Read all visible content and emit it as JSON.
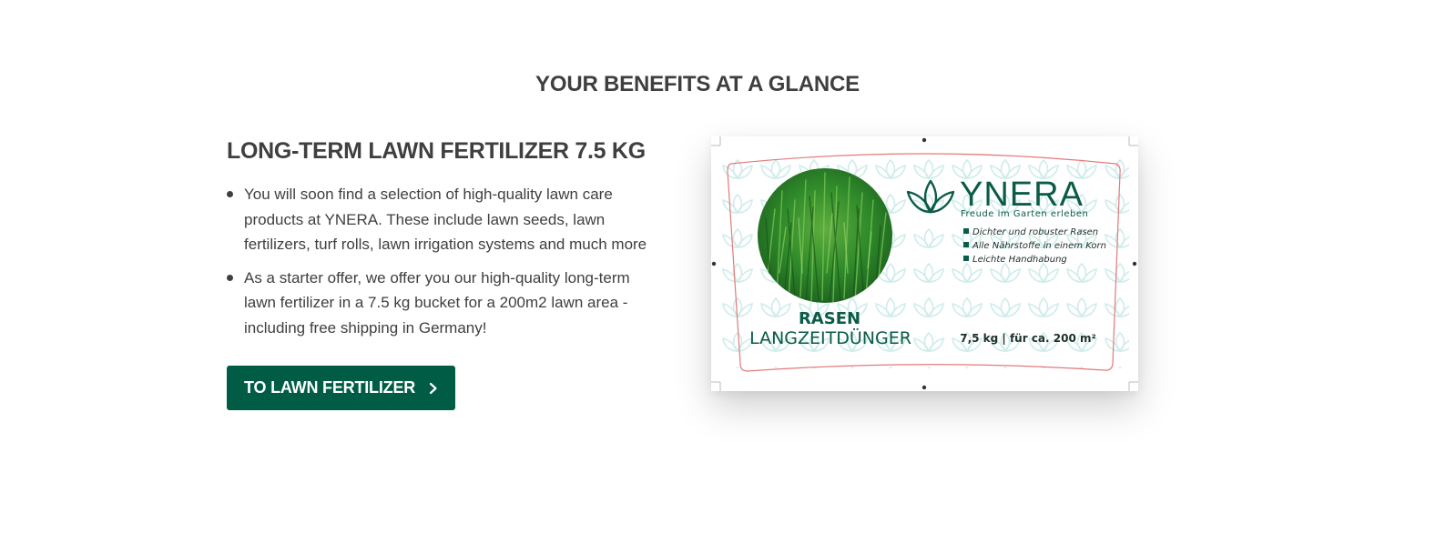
{
  "section": {
    "title": "YOUR BENEFITS AT A GLANCE"
  },
  "product": {
    "title": "LONG-TERM LAWN FERTILIZER 7.5 KG",
    "benefits": [
      "You will soon find a selection of high-quality lawn care products at YNERA. These include lawn seeds, lawn fertilizers, turf rolls, lawn irrigation systems and much more",
      "As a starter offer, we offer you our high-quality long-term lawn fertilizer in a 7.5 kg bucket for a 200m2 lawn area - including free shipping in Germany!"
    ],
    "cta_label": "TO LAWN FERTILIZER",
    "cta_icon": "chevron-right-icon"
  },
  "label_image": {
    "brand": "YNERA",
    "tagline": "Freude im Garten erleben",
    "features": [
      "Dichter und robuster Rasen",
      "Alle Nährstoffe in einem Korn",
      "Leichte Handhabung"
    ],
    "product_line1": "RASEN",
    "product_line2": "LANGZEITDÜNGER",
    "size_info": "7,5 kg | für ca. 200 m²"
  },
  "colors": {
    "brand_green": "#005c45",
    "text_dark": "#3f3f3f",
    "pattern": "#cfeceb",
    "cut_line": "#e27a7a"
  }
}
